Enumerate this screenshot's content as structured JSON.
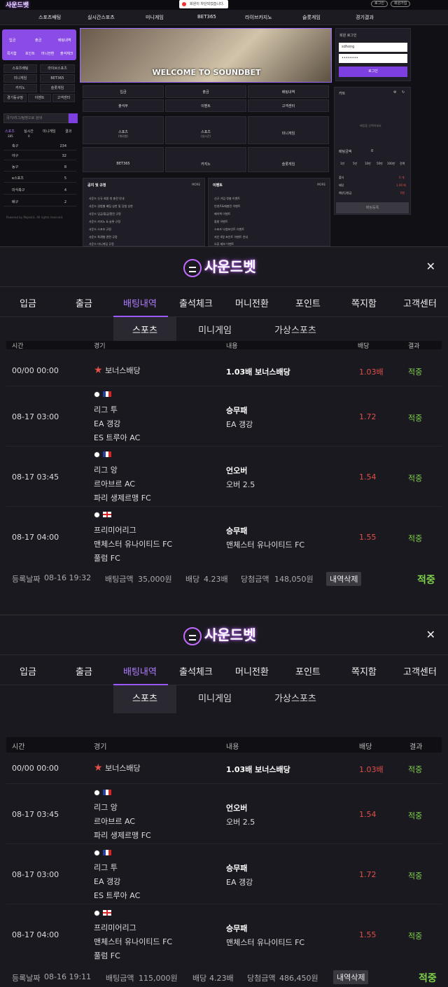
{
  "site": {
    "logo": "사운드벳",
    "toast": "회원이 차단되었습니다.",
    "login_btn": "로그인",
    "join_btn": "회원가입",
    "nav": [
      "스포츠배팅",
      "실시간스포츠",
      "미니게임",
      "BET365",
      "라이브카지노",
      "슬롯게임",
      "경기결과"
    ],
    "quick": [
      "입금",
      "출금",
      "배팅내역",
      "쪽지함",
      "포인트",
      "머니전환",
      "출석체크"
    ],
    "side_menu": [
      "스포츠배팅",
      "라이브스포츠",
      "미니게임",
      "BET365",
      "카지노",
      "슬롯게임",
      "경기등규정",
      "이벤트",
      "고객센터"
    ],
    "search_placeholder": "국가/리그/팀명으로 검색",
    "sport_tabs": [
      {
        "label": "스포츠",
        "count": "285"
      },
      {
        "label": "실시간",
        "count": "0"
      },
      {
        "label": "미니게임",
        "count": ""
      },
      {
        "label": "결과",
        "count": ""
      }
    ],
    "sports": [
      {
        "name": "축구",
        "count": "234"
      },
      {
        "name": "야구",
        "count": "32"
      },
      {
        "name": "농구",
        "count": "8"
      },
      {
        "name": "e스포츠",
        "count": "5"
      },
      {
        "name": "미식축구",
        "count": "4"
      },
      {
        "name": "배구",
        "count": "2"
      }
    ],
    "powered": "Powered by Majestic. All rights reserved.",
    "banner_text": "WELCOME TO SOUNDBET",
    "quick_grid": [
      "입금",
      "출금",
      "배팅내역",
      "출석부",
      "이벤트",
      "고객센터"
    ],
    "game_grid": [
      {
        "label": "스포츠",
        "sub": "(해외형)"
      },
      {
        "label": "스포츠",
        "sub": "(실시간)"
      },
      {
        "label": "미니게임",
        "sub": ""
      },
      {
        "label": "BET365",
        "sub": ""
      },
      {
        "label": "카지노",
        "sub": ""
      },
      {
        "label": "슬롯게임",
        "sub": ""
      }
    ],
    "notice_title": "공지 및 규정",
    "notice_more": "MORE",
    "notices": [
      "사운드 신규 회원 첫 충전 안내",
      "사운드 경험별 배팅 상한 및 당첨 상한",
      "사운드 입금/출금/환전 규정",
      "사운드 카지노 & 슬롯 규정",
      "사운드 스포츠 규정",
      "사운드 특례형 관련 규정",
      "사운드 미니게임 규정"
    ],
    "event_title": "이벤트",
    "event_more": "MORE",
    "events": [
      "신규 가입 첫충 이벤트",
      "빈센트&매충전 이벤트",
      "페이백 이벤트",
      "돌발 이벤트",
      "스포츠 낙첨포인트 이벤트",
      "지인 4명 포인트 이벤트 안내",
      "오류 제보 이벤트"
    ],
    "login_title": "회원 로그인",
    "login_id": "sdhong",
    "login_pw": "••••••••",
    "login_submit": "로그인",
    "cart_title": "카트",
    "cart_empty": "배팅을 선택하세요",
    "bet_amount_label": "배팅금액",
    "bet_amount": "0",
    "chips": [
      "1만",
      "5만",
      "10만",
      "50만",
      "100만",
      "전액"
    ],
    "cart_rows": [
      {
        "k": "폴더",
        "v": "0 개"
      },
      {
        "k": "배당",
        "v": "1.00 배"
      },
      {
        "k": "예상당첨금",
        "v": "0원"
      }
    ],
    "cart_submit": "배팅등록"
  },
  "modals": [
    {
      "logo": "사운드벳",
      "tabs": [
        "입금",
        "출금",
        "배팅내역",
        "출석체크",
        "머니전환",
        "포인트",
        "쪽지함",
        "고객센터"
      ],
      "active_tab": 2,
      "subtabs": [
        "스포츠",
        "미니게임",
        "가상스포츠"
      ],
      "headers": [
        "시간",
        "경기",
        "내용",
        "배당",
        "결과"
      ],
      "rows": [
        {
          "time": "00/00 00:00",
          "match": [
            "보너스배당"
          ],
          "bonus": true,
          "pick_label": "1.03배 보너스배당",
          "pick": "",
          "odds": "1.03배",
          "result": "적중"
        },
        {
          "time": "08-17 03:00",
          "flag": "fr",
          "match": [
            "리그 투",
            "EA 갱강",
            "ES 트루아 AC"
          ],
          "pick_label": "승무패",
          "pick": "EA 갱강",
          "odds": "1.72",
          "result": "적중"
        },
        {
          "time": "08-17 03:45",
          "flag": "fr",
          "match": [
            "리그 앙",
            "르아브르 AC",
            "파리 생제르맹 FC"
          ],
          "pick_label": "언오버",
          "pick": "오버 2.5",
          "odds": "1.54",
          "result": "적중"
        },
        {
          "time": "08-17 04:00",
          "flag": "en",
          "match": [
            "프리미어리그",
            "맨체스터 유나이티드 FC",
            "풀럼 FC"
          ],
          "pick_label": "승무패",
          "pick": "맨체스터 유나이티드 FC",
          "odds": "1.55",
          "result": "적중"
        }
      ],
      "footer": {
        "date_label": "등록날짜",
        "date": "08-16 19:32",
        "amount_label": "배팅금액",
        "amount": "35,000원",
        "odds_label": "배당",
        "odds": "4.23배",
        "win_label": "당첨금액",
        "win": "148,050원",
        "delete": "내역삭제",
        "result": "적중"
      }
    },
    {
      "logo": "사운드벳",
      "tabs": [
        "입금",
        "출금",
        "배팅내역",
        "출석체크",
        "머니전환",
        "포인트",
        "쪽지함",
        "고객센터"
      ],
      "active_tab": 2,
      "subtabs": [
        "스포츠",
        "미니게임",
        "가상스포츠"
      ],
      "headers": [
        "시간",
        "경기",
        "내용",
        "배당",
        "결과"
      ],
      "rows": [
        {
          "time": "00/00 00:00",
          "match": [
            "보너스배당"
          ],
          "bonus": true,
          "pick_label": "1.03배 보너스배당",
          "pick": "",
          "odds": "1.03배",
          "result": "적중"
        },
        {
          "time": "08-17 03:45",
          "flag": "fr",
          "match": [
            "리그 앙",
            "르아브르 AC",
            "파리 생제르맹 FC"
          ],
          "pick_label": "언오버",
          "pick": "오버 2.5",
          "odds": "1.54",
          "result": "적중"
        },
        {
          "time": "08-17 03:00",
          "flag": "fr",
          "match": [
            "리그 투",
            "EA 갱강",
            "ES 트루아 AC"
          ],
          "pick_label": "승무패",
          "pick": "EA 갱강",
          "odds": "1.72",
          "result": "적중"
        },
        {
          "time": "08-17 04:00",
          "flag": "en",
          "match": [
            "프리미어리그",
            "맨체스터 유나이티드 FC",
            "풀럼 FC"
          ],
          "pick_label": "승무패",
          "pick": "맨체스터 유나이티드 FC",
          "odds": "1.55",
          "result": "적중"
        }
      ],
      "footer": {
        "date_label": "등록날짜",
        "date": "08-16 19:11",
        "amount_label": "배팅금액",
        "amount": "115,000원",
        "odds_label": "배당",
        "odds": "4.23배",
        "win_label": "당첨금액",
        "win": "486,450원",
        "delete": "내역삭제",
        "result": "적중"
      }
    }
  ]
}
